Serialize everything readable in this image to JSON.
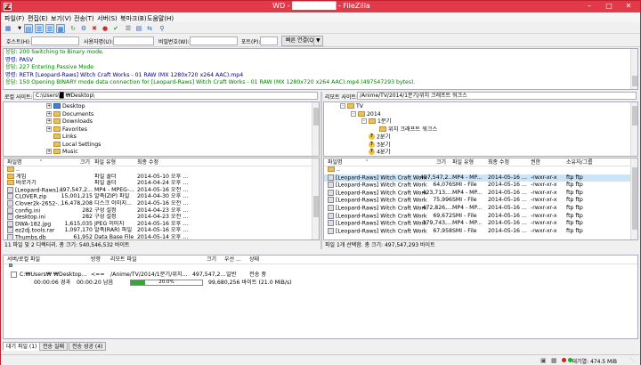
{
  "window": {
    "title": "WD - ████████ - FileZilla",
    "app_icon": "Fz"
  },
  "menu": [
    "파일(F)",
    "편집(E)",
    "보기(V)",
    "전송(T)",
    "서버(S)",
    "북마크(B)",
    "도움말(H)"
  ],
  "quickconnect": {
    "host_label": "호스트(H):",
    "user_label": "사용자명(U):",
    "pass_label": "비밀번호(W):",
    "port_label": "포트(P):",
    "button": "빠른 연결(Q)"
  },
  "log": [
    {
      "tag": "응답:",
      "text": "200 Switching to Binary mode.",
      "color": "#008000"
    },
    {
      "tag": "명령:",
      "text": "PASV",
      "color": "#000080"
    },
    {
      "tag": "응답:",
      "text": "227 Entering Passive Mode",
      "color": "#008000"
    },
    {
      "tag": "명령:",
      "text": "RETR [Leopard-Raws] Witch Craft Works - 01 RAW (MX 1280x720 x264 AAC).mp4",
      "color": "#000080"
    },
    {
      "tag": "응답:",
      "text": "150 Opening BINARY mode data connection for [Leopard-Raws] Witch Craft Works - 01 RAW (MX 1280x720 x264 AAC).mp4 (497547293 bytes).",
      "color": "#008000"
    }
  ],
  "local": {
    "site_label": "로컬 사이트:",
    "path": "C:\\Users\\█ ₩Desktop\\",
    "tree": [
      {
        "label": "Desktop",
        "indent": 1,
        "exp": "+"
      },
      {
        "label": "Documents",
        "indent": 1,
        "exp": "+"
      },
      {
        "label": "Downloads",
        "indent": 1,
        "exp": "+"
      },
      {
        "label": "Favorites",
        "indent": 1,
        "exp": "+"
      },
      {
        "label": "Links",
        "indent": 1,
        "exp": ""
      },
      {
        "label": "Local Settings",
        "indent": 1,
        "exp": ""
      },
      {
        "label": "Music",
        "indent": 1,
        "exp": "+"
      }
    ],
    "columns": [
      "파일명",
      "크기",
      "파일 유형",
      "최종 수정"
    ],
    "files": [
      {
        "name": "..",
        "size": "",
        "type": "",
        "modified": ""
      },
      {
        "name": "게임",
        "size": "",
        "type": "파일 폴더",
        "modified": "2014-05-10 오후 ..."
      },
      {
        "name": "바로가기",
        "size": "",
        "type": "파일 폴더",
        "modified": "2014-04-24 오후 ..."
      },
      {
        "name": "[Leopard-Raws]...",
        "size": "497,547,2...",
        "type": "MP4 - MPEG-...",
        "modified": "2014-05-16 오전 ..."
      },
      {
        "name": "CLOVER.zip",
        "size": "15,001,215",
        "type": "알축(ZIP) 파일",
        "modified": "2014-04-30 오후 ..."
      },
      {
        "name": "Clover2k-2652-...",
        "size": "16,478,208",
        "type": "디스크 이미지...",
        "modified": "2014-05-16 오전 ..."
      },
      {
        "name": "config.ini",
        "size": "282",
        "type": "구성 설정",
        "modified": "2014-04-23 오후 ..."
      },
      {
        "name": "desktop.ini",
        "size": "282",
        "type": "구성 설정",
        "modified": "2014-04-23 오전 ..."
      },
      {
        "name": "DWA-182.jpg",
        "size": "1,615,035",
        "type": "JPEG 이미지",
        "modified": "2014-05-16 오후 ..."
      },
      {
        "name": "ez2dj.tools.rar",
        "size": "1,097,170",
        "type": "알축(RAR) 파일",
        "modified": "2014-05-16 오후 ..."
      },
      {
        "name": "Thumbs.db",
        "size": "61,952",
        "type": "Data Base File",
        "modified": "2014-05-14 오후 ..."
      }
    ],
    "status": "11 파일 및 2 디렉터리. 총 크기: 540,546,532 바이트"
  },
  "remote": {
    "site_label": "리모트 사이트:",
    "path": "/Anime/TV/2014/1분기/위치 크래프트 워크스",
    "tree": [
      {
        "label": "TV",
        "indent": 0,
        "exp": "-",
        "icon": "folder"
      },
      {
        "label": "2014",
        "indent": 1,
        "exp": "-",
        "icon": "folder"
      },
      {
        "label": "1분기",
        "indent": 2,
        "exp": "-",
        "icon": "folder"
      },
      {
        "label": "위치 크래프트 워크스",
        "indent": 3,
        "exp": "",
        "icon": "folder"
      },
      {
        "label": "2분기",
        "indent": 2,
        "exp": "",
        "icon": "q"
      },
      {
        "label": "3분기",
        "indent": 2,
        "exp": "",
        "icon": "q"
      },
      {
        "label": "4분기",
        "indent": 2,
        "exp": "",
        "icon": "q"
      }
    ],
    "columns": [
      "파일명",
      "크기",
      "파일 유형",
      "최종 수정",
      "권한",
      "소유자/그룹"
    ],
    "files": [
      {
        "name": "..",
        "size": "",
        "type": "",
        "modified": "",
        "perm": "",
        "owner": ""
      },
      {
        "name": "[Leopard-Raws] Witch Craft Works...",
        "size": "497,547,2...",
        "type": "MP4 - MP...",
        "modified": "2014-05-16 ...",
        "perm": "-rwxr-xr-x",
        "owner": "ftp ftp"
      },
      {
        "name": "[Leopard-Raws] Witch Craft Works...",
        "size": "64,076",
        "type": "SMI - File",
        "modified": "2014-05-16 ...",
        "perm": "-rwxr-xr-x",
        "owner": "ftp ftp"
      },
      {
        "name": "[Leopard-Raws] Witch Craft Works...",
        "size": "423,713,...",
        "type": "MP4 - MP...",
        "modified": "2014-05-16 ...",
        "perm": "-rwxr-xr-x",
        "owner": "ftp ftp"
      },
      {
        "name": "[Leopard-Raws] Witch Craft Works...",
        "size": "75,996",
        "type": "SMI - File",
        "modified": "2014-05-16 ...",
        "perm": "-rwxr-xr-x",
        "owner": "ftp ftp"
      },
      {
        "name": "[Leopard-Raws] Witch Craft Works...",
        "size": "472,826,...",
        "type": "MP4 - MP...",
        "modified": "2014-05-16 ...",
        "perm": "-rwxr-xr-x",
        "owner": "ftp ftp"
      },
      {
        "name": "[Leopard-Raws] Witch Craft Works...",
        "size": "69,672",
        "type": "SMI - File",
        "modified": "2014-05-16 ...",
        "perm": "-rwxr-xr-x",
        "owner": "ftp ftp"
      },
      {
        "name": "[Leopard-Raws] Witch Craft Works...",
        "size": "379,743,...",
        "type": "MP4 - MP...",
        "modified": "2014-05-16 ...",
        "perm": "-rwxr-xr-x",
        "owner": "ftp ftp"
      },
      {
        "name": "[Leopard-Raws] Witch Craft Works...",
        "size": "67,958",
        "type": "SMI - File",
        "modified": "2014-05-16 ...",
        "perm": "-rwxr-xr-x",
        "owner": "ftp ftp"
      }
    ],
    "status": "파일 1개 선택함. 총 크기: 497,547,293 바이트"
  },
  "queue": {
    "columns": [
      "서버/로컬 파일",
      "방향",
      "리모트 파일",
      "크기",
      "우선 ...",
      "상태"
    ],
    "row1": {
      "local": "C:₩Users₩ ₩Desktop...",
      "direction": "<==",
      "remote": "/Anime/TV/2014/1분기/위치...",
      "size": "497,547,2...",
      "priority": "일반",
      "status": "전송 중"
    },
    "row2": {
      "elapsed": "00:00:06 경과",
      "remaining": "00:00:20 남음",
      "progress_label": "20.0%",
      "progress": 0.2,
      "transferred": "99,680,256 바이트 (21.0 MiB/s)"
    }
  },
  "tabs": [
    "대기 파일 (1)",
    "전송 실패",
    "전송 성공 (4)"
  ],
  "statusbar": {
    "queue_size": "대기열: 474.5 MiB"
  }
}
